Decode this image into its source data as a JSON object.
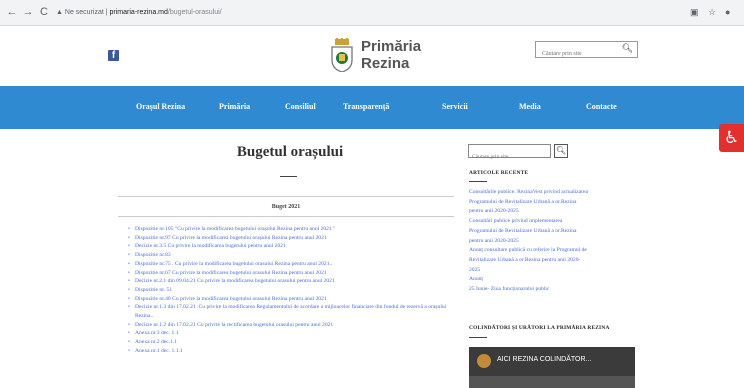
{
  "browser": {
    "back_icon": "←",
    "forward_icon": "→",
    "reload_icon": "C",
    "security_label": "Ne securizat",
    "url_host": "primaria-rezina.md",
    "url_path": "/bugetul-orasului/",
    "separator": "|"
  },
  "header": {
    "facebook_glyph": "f",
    "logo_line1": "Primăria",
    "logo_line2": "Rezina",
    "search_placeholder": "Căutare prin site",
    "search_icon": "search-icon"
  },
  "nav": {
    "items": [
      "Orașul Rezina",
      "Primăria",
      "Consiliul",
      "Transparență",
      "Servicii",
      "Media",
      "Contacte"
    ]
  },
  "main": {
    "title": "Bugetul orașului",
    "section_title": "Buget 2021",
    "documents": [
      "Dispozitie nr.105 \"Cu privire la modificarea bugetului orașului Rezina pentru anul 2021 \"",
      "Dispozitie nr.97 Cu privire la modificarea bugetului orașului Rezina pentru anul 2021",
      "Decizie nr.3.5 Cu privire la modificarea bugetului pentru anul 2021",
      "Dispozitie nr.83",
      "Dispozitie nr.75 . Cu privire la modificarea bugetului orasului Rezina pentru anul 2021..",
      "Dispozitie nr.67 Cu privire la modificarea bugetului orasului Rezina pentru anul 2021",
      "Decizie nr.2.1 din 09.04.21 Cu privire la modificarea bugetului orasului pentru anul 2021",
      "Dispozitie nr. 51",
      "Dispozitie nr.40 Cu privire la modificarea bugetului orasului Rezina pentru anul 2021",
      "Decizie nr.1.3 din 17.02.21 .Cu privire la modificarea Regulamentului de acordare a mijloacelor financiare din fondul de rezervă a orașului Rezina..",
      "Decizie nr.1.2 din 17.02.21 Cu privire la rectificarea bugetului orasului pentru anul 2021",
      "Anexa nr.3 dec. 1.1",
      "Anexa nr.2 dec.1.1",
      "Anexa nr.1 dec. 1.1.1"
    ]
  },
  "sidebar": {
    "search_placeholder": "Căutare prin site",
    "search_icon": "search-icon",
    "recent_heading": "ARTICOLE RECENTE",
    "recent_items": [
      "Consultările publice: RezinaVest privind actualizarea",
      "Programului de Revitalizare Urbană a or.Rezina",
      "pentru anii 2020-2025",
      "Consultări publice privind implementarea",
      "Programului de Revitalizare Urbană a or.Rezina",
      "pentru anii 2020-2025",
      "Anunț consultare publică cu referire la Programul de",
      "Revitalizare Urbană a or.Rezina pentru anii 2020-",
      "2025",
      "Anunț",
      "25 Iunie- Ziua funcționarului public"
    ],
    "video_heading": "COLINDĂTORI ȘI URĂTORI LA PRIMĂRIA REZINA",
    "video_title": "AICI REZINA COLINDĂTOR..."
  },
  "accessibility_icon": "♿",
  "colors": {
    "nav_blue": "#2f8ad1",
    "link_blue": "#4a6bd6",
    "a11y_red": "#e2302e",
    "facebook_blue": "#3b5998"
  }
}
